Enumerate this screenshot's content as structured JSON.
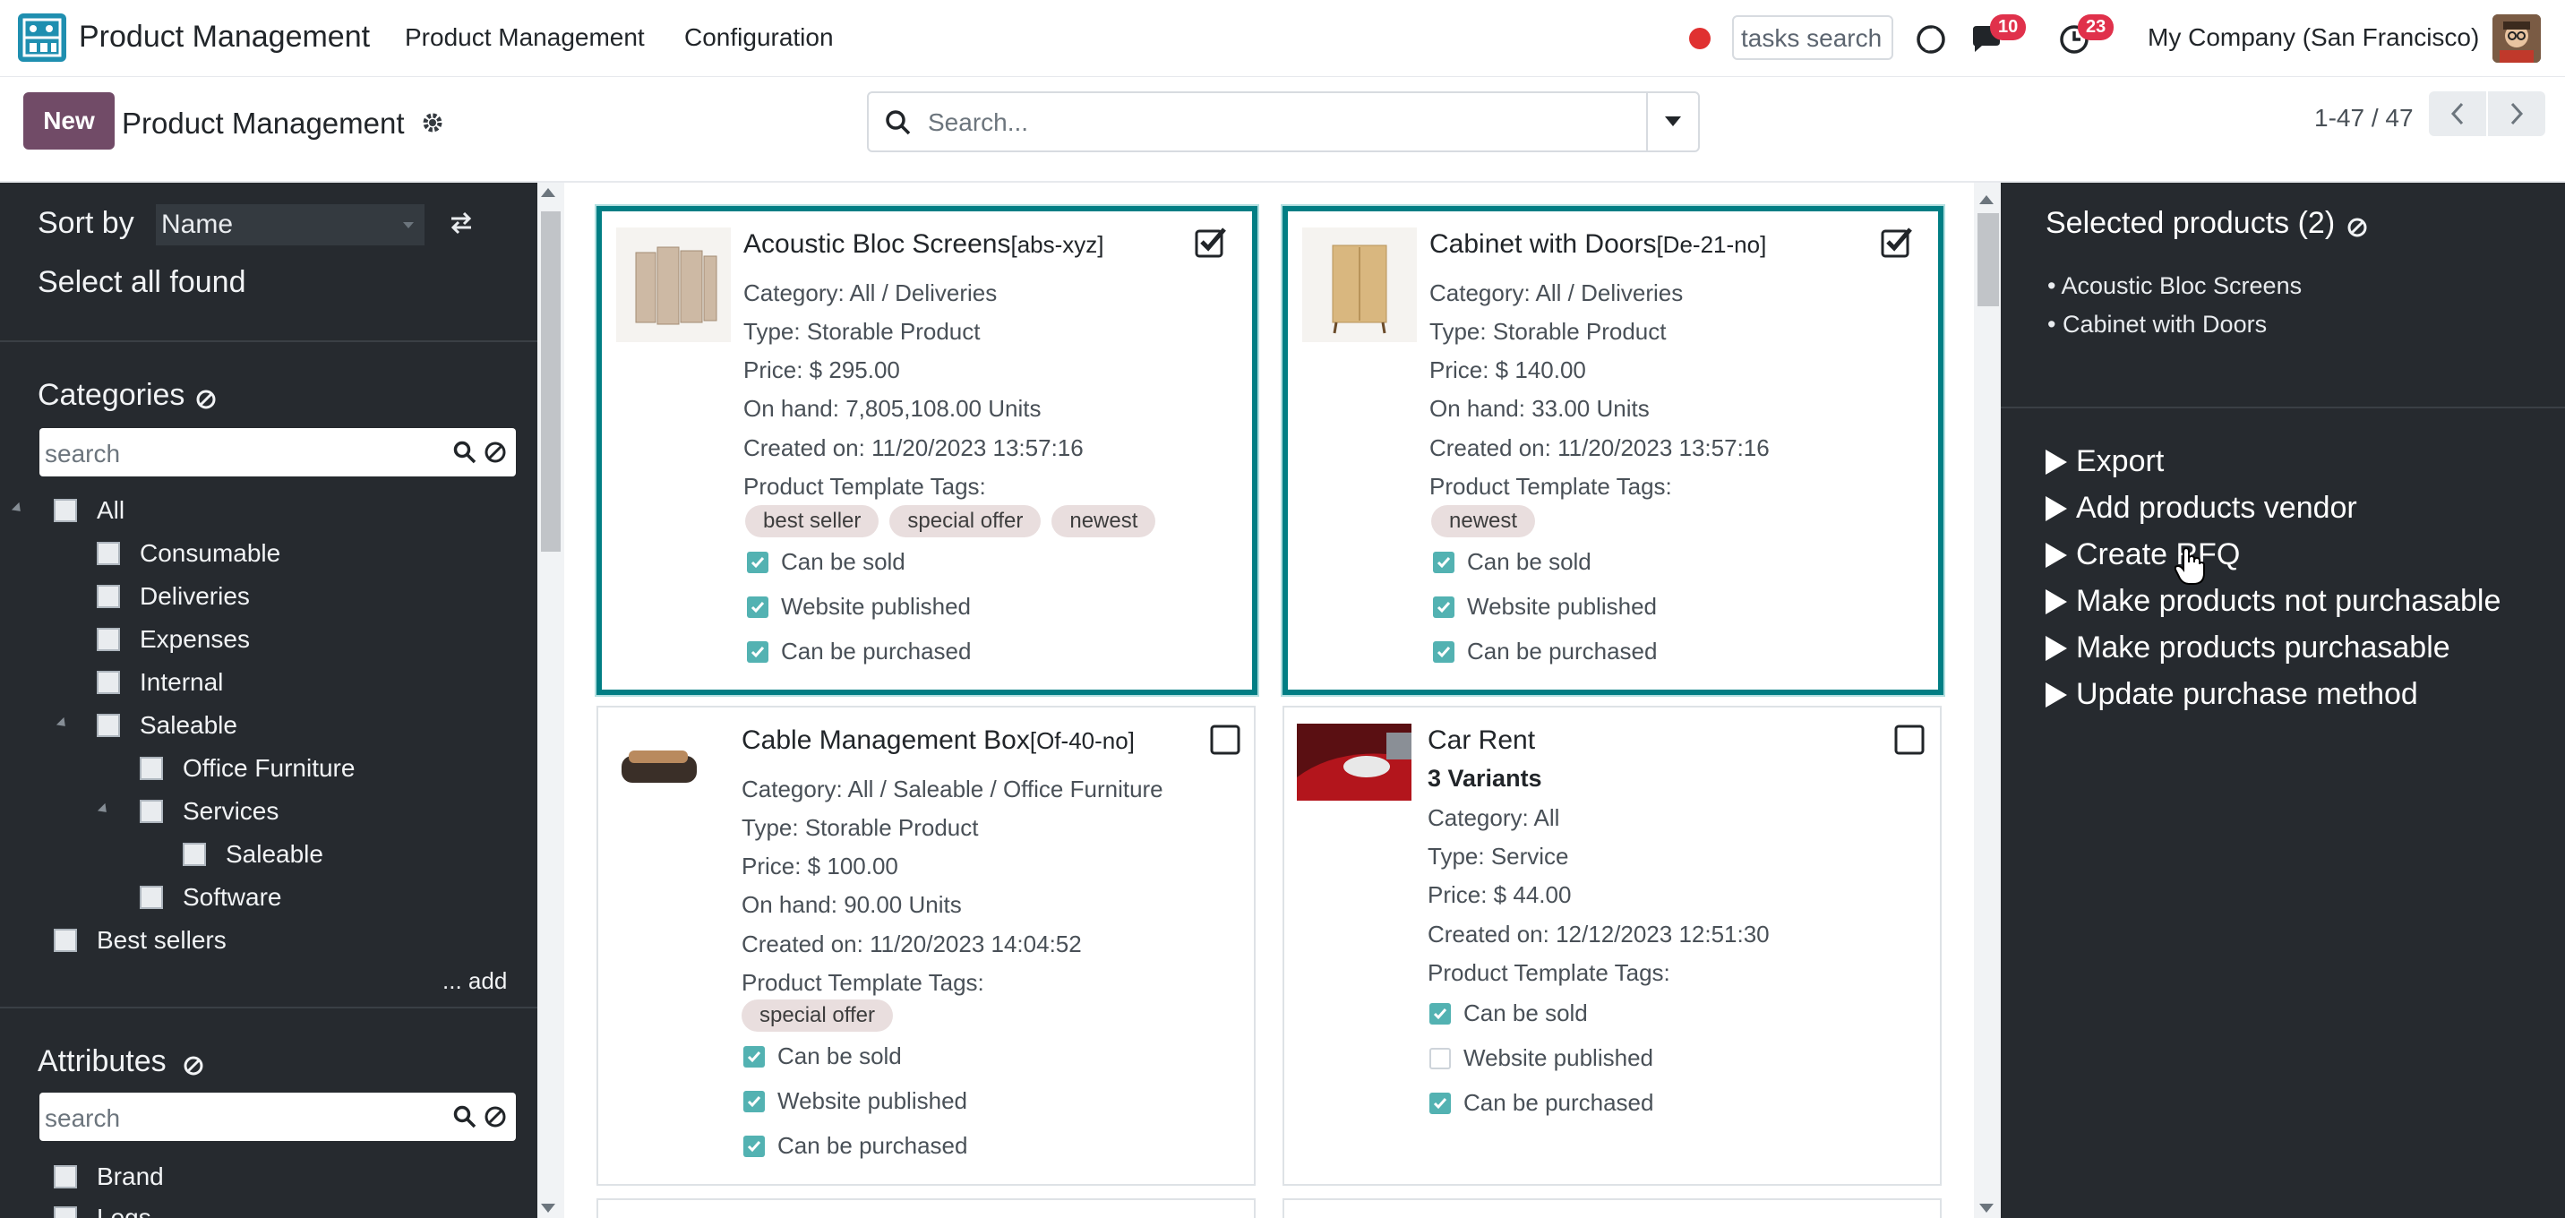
{
  "topbar": {
    "app_name": "Product Management",
    "nav": [
      "Product Management",
      "Configuration"
    ],
    "tasks_search_placeholder": "tasks search",
    "messages_count": "10",
    "activities_count": "23",
    "company": "My Company (San Francisco)"
  },
  "control": {
    "new_label": "New",
    "title": "Product Management",
    "search_placeholder": "Search...",
    "pager": "1-47 / 47"
  },
  "left": {
    "sort_by_label": "Sort by",
    "sort_value": "Name",
    "select_all": "Select all found",
    "categories_title": "Categories",
    "categories_search_placeholder": "search",
    "categories": [
      {
        "label": "All"
      },
      {
        "label": "Consumable"
      },
      {
        "label": "Deliveries"
      },
      {
        "label": "Expenses"
      },
      {
        "label": "Internal"
      },
      {
        "label": "Saleable"
      },
      {
        "label": "Office Furniture"
      },
      {
        "label": "Services"
      },
      {
        "label": "Saleable"
      },
      {
        "label": "Software"
      },
      {
        "label": "Best sellers"
      }
    ],
    "add_label": "... add",
    "attributes_title": "Attributes",
    "attributes_search_placeholder": "search",
    "attributes": [
      {
        "label": "Brand"
      },
      {
        "label": "Legs"
      }
    ]
  },
  "cards": [
    {
      "name": "Acoustic Bloc Screens",
      "ref": "[abs-xyz]",
      "category": "Category: All / Deliveries",
      "type": "Type: Storable Product",
      "price": "Price: $ 295.00",
      "onhand": "On hand: 7,805,108.00 Units",
      "created": "Created on: 11/20/2023 13:57:16",
      "tags_label": "Product Template Tags:",
      "tags": [
        "best seller",
        "special offer",
        "newest"
      ],
      "can_be_sold": "Can be sold",
      "website_published": "Website published",
      "can_be_purchased": "Can be purchased"
    },
    {
      "name": "Cabinet with Doors",
      "ref": "[De-21-no]",
      "category": "Category: All / Deliveries",
      "type": "Type: Storable Product",
      "price": "Price: $ 140.00",
      "onhand": "On hand: 33.00 Units",
      "created": "Created on: 11/20/2023 13:57:16",
      "tags_label": "Product Template Tags:",
      "tags": [
        "newest"
      ],
      "can_be_sold": "Can be sold",
      "website_published": "Website published",
      "can_be_purchased": "Can be purchased"
    },
    {
      "name": "Cable Management Box",
      "ref": "[Of-40-no]",
      "category": "Category: All / Saleable / Office Furniture",
      "type": "Type: Storable Product",
      "price": "Price: $ 100.00",
      "onhand": "On hand: 90.00 Units",
      "created": "Created on: 11/20/2023 14:04:52",
      "tags_label": "Product Template Tags:",
      "tags": [
        "special offer"
      ],
      "can_be_sold": "Can be sold",
      "website_published": "Website published",
      "can_be_purchased": "Can be purchased"
    },
    {
      "name": "Car Rent",
      "variants": "3 Variants",
      "category": "Category: All",
      "type": "Type: Service",
      "price": "Price: $ 44.00",
      "created": "Created on: 12/12/2023 12:51:30",
      "tags_label": "Product Template Tags:",
      "can_be_sold": "Can be sold",
      "website_published": "Website published",
      "can_be_purchased": "Can be purchased"
    }
  ],
  "right": {
    "selected_title": "Selected products (2)",
    "selected": [
      "Acoustic Bloc Screens",
      "Cabinet with Doors"
    ],
    "actions": [
      "Export",
      "Add products vendor",
      "Create RFQ",
      "Make products not purchasable",
      "Make products purchasable",
      "Update purchase method"
    ]
  },
  "colors": {
    "accent": "#714b67",
    "teal": "#017e84",
    "panel": "#262a2f",
    "badge": "#e0314b"
  }
}
